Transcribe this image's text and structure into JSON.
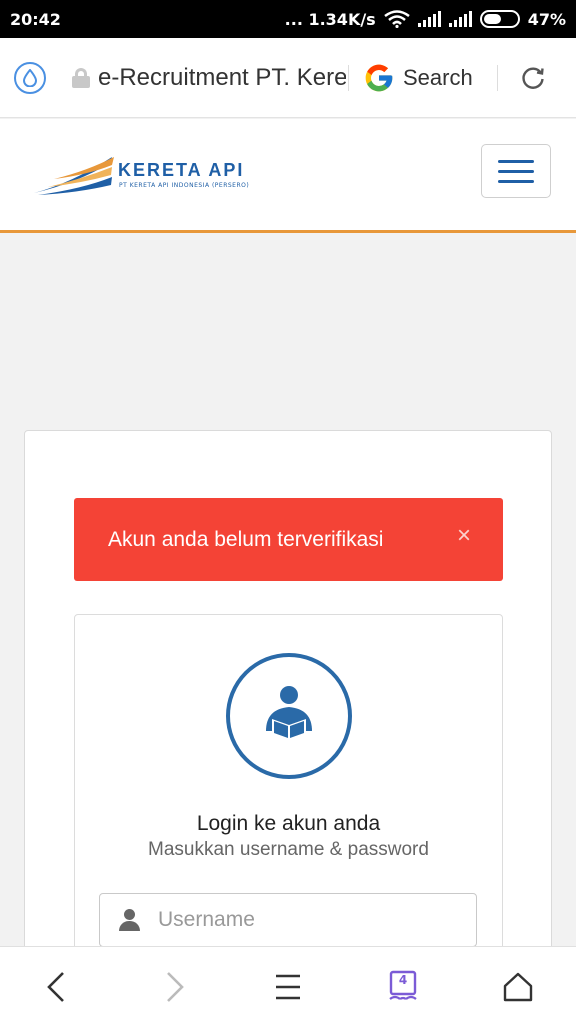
{
  "status_bar": {
    "time": "20:42",
    "network_speed": "... 1.34K/s",
    "battery": "47%"
  },
  "browser": {
    "url": "e-Recruitment PT. Kereta Api",
    "search_label": "Search"
  },
  "site": {
    "logo_title": "KERETA API",
    "logo_subtitle": "PT KERETA API INDONESIA (PERSERO)"
  },
  "alert": {
    "message": "Akun anda belum terverifikasi",
    "close": "×"
  },
  "login": {
    "title": "Login ke akun anda",
    "subtitle": "Masukkan username & password",
    "username_placeholder": "Username"
  },
  "bottom_nav": {
    "tabs_count": "4"
  },
  "colors": {
    "brand_blue": "#1f5fa6",
    "accent_orange": "#e8983a",
    "alert_red": "#f44336"
  }
}
